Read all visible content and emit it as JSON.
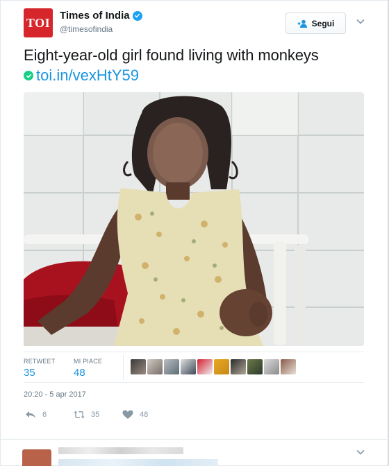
{
  "tweet": {
    "author_name": "Times of India",
    "handle": "@timesofindia",
    "avatar_text": "TOI",
    "follow_label": "Segui",
    "text": "Eight-year-old girl found living with monkeys",
    "link": "toi.in/vexHtY59",
    "stats": {
      "retweet_label": "RETWEET",
      "retweet_count": "35",
      "likes_label": "MI PIACE",
      "likes_count": "48"
    },
    "timestamp": "20:20 - 5 apr 2017",
    "actions": {
      "reply_count": "6",
      "retweet_count": "35",
      "like_count": "48"
    }
  },
  "colors": {
    "brand_red": "#d6262c",
    "link_blue": "#1b95e0",
    "verified_blue": "#1da1f2",
    "link_icon_green": "#19cf86",
    "muted": "#657786"
  },
  "icons": [
    "verified-badge-icon",
    "follow-user-icon",
    "chevron-down-icon",
    "link-icon",
    "reply-icon",
    "retweet-icon",
    "heart-icon"
  ]
}
